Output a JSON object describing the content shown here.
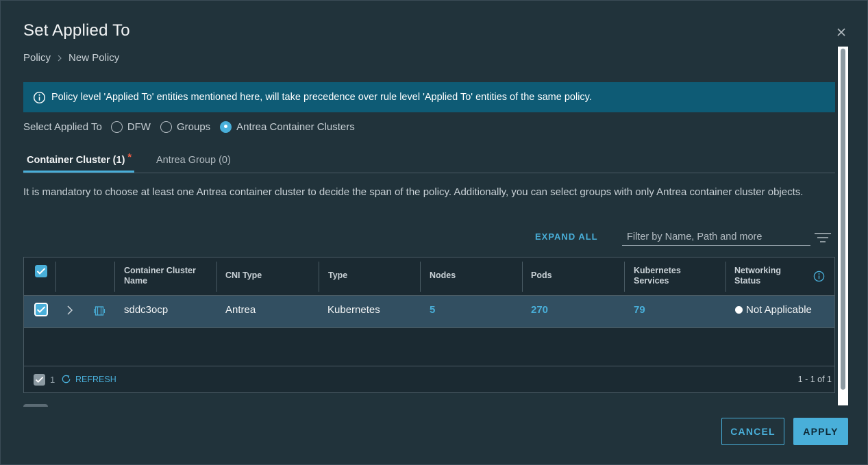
{
  "dialog": {
    "title": "Set Applied To",
    "breadcrumb": [
      "Policy",
      "New Policy"
    ]
  },
  "banner": {
    "icon": "info-icon",
    "text": "Policy level 'Applied To' entities mentioned here, will take precedence over rule level 'Applied To' entities of the same policy."
  },
  "applied_to": {
    "label": "Select Applied To",
    "options": [
      {
        "label": "DFW",
        "selected": false
      },
      {
        "label": "Groups",
        "selected": false
      },
      {
        "label": "Antrea Container Clusters",
        "selected": true
      }
    ]
  },
  "tabs": [
    {
      "label": "Container Cluster (1)",
      "required_marker": "*",
      "active": true
    },
    {
      "label": "Antrea Group (0)",
      "active": false
    }
  ],
  "description": "It is mandatory to choose at least one Antrea container cluster to decide the span of the policy. Additionally, you can select groups with only Antrea container cluster objects.",
  "toolbar": {
    "expand_all": "EXPAND ALL",
    "filter_placeholder": "Filter by Name, Path and more"
  },
  "grid": {
    "columns": [
      {
        "line1": "Container Cluster",
        "line2": "Name"
      },
      {
        "line1": "CNI Type",
        "line2": ""
      },
      {
        "line1": "Type",
        "line2": ""
      },
      {
        "line1": "Nodes",
        "line2": ""
      },
      {
        "line1": "Pods",
        "line2": ""
      },
      {
        "line1": "Kubernetes",
        "line2": "Services"
      },
      {
        "line1": "Networking",
        "line2": "Status"
      }
    ],
    "rows": [
      {
        "selected": true,
        "name": "sddc3ocp",
        "cni_type": "Antrea",
        "type": "Kubernetes",
        "nodes": "5",
        "pods": "270",
        "services": "79",
        "status": "Not Applicable"
      }
    ],
    "footer": {
      "selected_count": "1",
      "refresh": "REFRESH",
      "pagination": "1 - 1 of 1"
    }
  },
  "actions": {
    "cancel": "CANCEL",
    "apply": "APPLY"
  },
  "colors": {
    "accent": "#49afd9",
    "banner": "#0e5b75",
    "required": "#f35e44",
    "selected_row": "#324f61"
  }
}
